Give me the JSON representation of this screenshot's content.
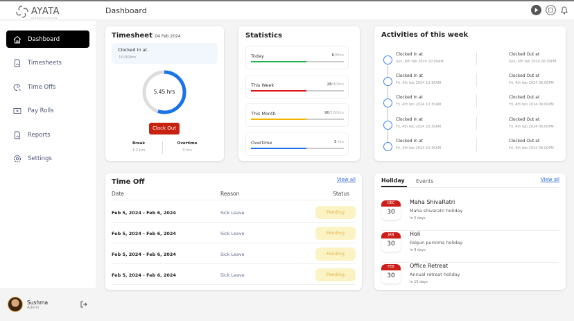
{
  "header": {
    "logo_text": "AYATA",
    "logo_sub": "INCORPORATION",
    "title": "Dashboard"
  },
  "sidebar": {
    "items": [
      {
        "label": "Dashboard",
        "icon": "home-icon",
        "active": true
      },
      {
        "label": "Timesheets",
        "icon": "report-icon"
      },
      {
        "label": "Time Offs",
        "icon": "clock-x-icon"
      },
      {
        "label": "Pay Rolls",
        "icon": "payroll-icon"
      },
      {
        "label": "Reports",
        "icon": "report-icon"
      },
      {
        "label": "Settings",
        "icon": "gear-icon"
      }
    ],
    "user": {
      "name": "Sushma",
      "role": "Admin"
    }
  },
  "timesheet": {
    "title": "Timesheet",
    "date": "04 Feb 2024",
    "clocked_label": "Clocked In at",
    "clocked_time": "10:00Am",
    "hours": "5.45 hrs",
    "progress": 0.55,
    "clock_out": "Clock Out",
    "break_label": "Break",
    "break_value": "1.2 hrs",
    "overtime_label": "Overtime",
    "overtime_value": "3 hrs"
  },
  "statistics": {
    "title": "Statistics",
    "items": [
      {
        "label": "Today",
        "value": "6",
        "total": "/8hrs",
        "fill": 0.6,
        "color": "#22b14c"
      },
      {
        "label": "This Week",
        "value": "28",
        "total": "/40hrs",
        "fill": 0.6,
        "color": "#d7141a"
      },
      {
        "label": "This Month",
        "value": "90",
        "total": "/160hrs",
        "fill": 0.6,
        "color": "#f5b400"
      },
      {
        "label": "Overtime",
        "value": "5",
        "total": " hrs",
        "fill": 0.6,
        "color": "#1a73e8"
      }
    ]
  },
  "activities": {
    "title": "Activities of this week",
    "items": [
      {
        "in_label": "Clocked In at",
        "in_time": "Sun, 4th feb 2024 10:00AM",
        "out_label": "Clocked Out at",
        "out_time": "Sun, 4th feb 2024 06:00PM"
      },
      {
        "in_label": "Clocked In at",
        "in_time": "Fri, 4th feb 2024 10:30AM",
        "out_label": "Clocked Out at",
        "out_time": "Fri, 4th feb 2024 06:00PM"
      },
      {
        "in_label": "Clocked In at",
        "in_time": "Fri, 4th feb 2024 10:30AM",
        "out_label": "Clocked Out at",
        "out_time": "Fri, 4th feb 2024 06:00PM"
      },
      {
        "in_label": "Clocked In at",
        "in_time": "Fri, 4th feb 2024 10:30AM",
        "out_label": "Clocked Out at",
        "out_time": "Fri, 4th feb 2024 06:00PM"
      },
      {
        "in_label": "Clocked In at",
        "in_time": "Fri, 4th feb 2024 10:30AM",
        "out_label": "Clocked Out at",
        "out_time": "Fri, 4th feb 2024 06:00PM"
      }
    ]
  },
  "timeoff": {
    "title": "Time Off",
    "view_all": "View all",
    "columns": [
      "Date",
      "Reason",
      "Status"
    ],
    "rows": [
      {
        "date": "Feb 5, 2024 - Feb 6, 2024",
        "reason": "Sick Leave",
        "status": "Pending"
      },
      {
        "date": "Feb 5, 2024 - Feb 6, 2024",
        "reason": "Sick Leave",
        "status": "Pending"
      },
      {
        "date": "Feb 5, 2024 - Feb 6, 2024",
        "reason": "Sick Leave",
        "status": "Pending"
      },
      {
        "date": "Feb 5, 2024 - Feb 6, 2024",
        "reason": "Sick Leave",
        "status": "Pending"
      }
    ]
  },
  "holidays": {
    "tabs": [
      "Holiday",
      "Events"
    ],
    "active_tab": "Holiday",
    "view_all": "View all",
    "items": [
      {
        "month": "DEC",
        "day": "30",
        "name": "Maha ShivaRatri",
        "desc": "Maha shivaratri holiday",
        "when": "In 5 days"
      },
      {
        "month": "JAN",
        "day": "30",
        "name": "Holi",
        "desc": "Falgun purnima holiday",
        "when": "In 8 days"
      },
      {
        "month": "FEB",
        "day": "30",
        "name": "Office Retreat",
        "desc": "Annual retreat holiday",
        "when": "In 15 days"
      }
    ]
  }
}
